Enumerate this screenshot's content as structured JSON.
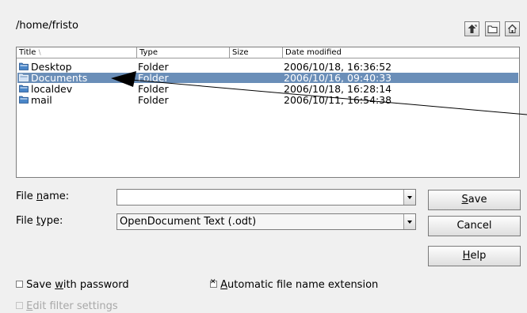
{
  "path": "/home/fristo",
  "toolbar": {
    "up_icon": "up-folder-icon",
    "new_folder_icon": "new-folder-icon",
    "home_icon": "home-folder-icon"
  },
  "columns": {
    "title": "Title",
    "type": "Type",
    "size": "Size",
    "date": "Date modified"
  },
  "files": [
    {
      "name": "Desktop",
      "type": "Folder",
      "size": "",
      "date": "2006/10/18, 16:36:52",
      "selected": false
    },
    {
      "name": "Documents",
      "type": "Folder",
      "size": "",
      "date": "2006/10/16, 09:40:33",
      "selected": true
    },
    {
      "name": "localdev",
      "type": "Folder",
      "size": "",
      "date": "2006/10/18, 16:28:14",
      "selected": false
    },
    {
      "name": "mail",
      "type": "Folder",
      "size": "",
      "date": "2006/10/11, 16:54:38",
      "selected": false
    }
  ],
  "file_name": {
    "label_pre": "File ",
    "label_u": "n",
    "label_post": "ame:",
    "value": ""
  },
  "file_type": {
    "label_pre": "File ",
    "label_u": "t",
    "label_post": "ype:",
    "value": "OpenDocument Text (.odt)"
  },
  "buttons": {
    "save_u": "S",
    "save_rest": "ave",
    "cancel": "Cancel",
    "help_u": "H",
    "help_rest": "elp"
  },
  "options": {
    "save_pw_pre": "Save ",
    "save_pw_u": "w",
    "save_pw_post": "ith password",
    "auto_ext_u": "A",
    "auto_ext_post": "utomatic file name extension",
    "edit_filter_u": "E",
    "edit_filter_post": "dit filter settings"
  },
  "colors": {
    "selection": "#6a8eb8",
    "background": "#f0f0f0"
  }
}
